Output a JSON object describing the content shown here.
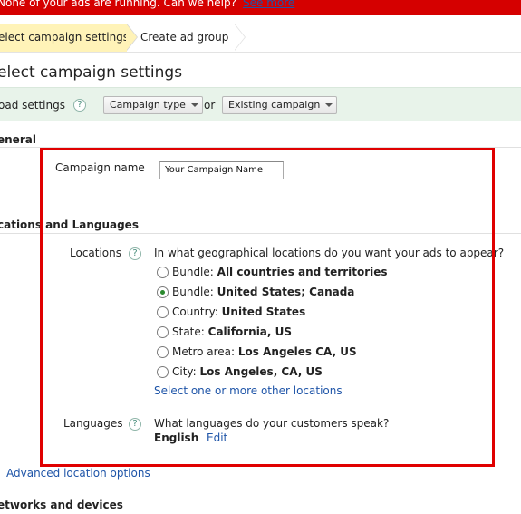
{
  "alert": {
    "text": "None of your ads are running. Can we help?",
    "link": "See more"
  },
  "steps": {
    "active": "elect campaign settings",
    "next": "Create ad group"
  },
  "page_title": "elect campaign settings",
  "load_settings": {
    "label": "oad settings",
    "campaign_type_button": "Campaign type",
    "or": "or",
    "existing_campaign_button": "Existing campaign"
  },
  "general": {
    "heading": "eneral",
    "campaign_name_label": "Campaign name",
    "campaign_name_value": "Your Campaign Name"
  },
  "locations_languages": {
    "heading": "cations and Languages",
    "locations_label": "Locations",
    "locations_question": "In what geographical locations do you want your ads to appear?",
    "options": [
      {
        "prefix": "Bundle:",
        "value": "All countries and territories",
        "checked": false
      },
      {
        "prefix": "Bundle:",
        "value": "United States; Canada",
        "checked": true
      },
      {
        "prefix": "Country:",
        "value": "United States",
        "checked": false
      },
      {
        "prefix": "State:",
        "value": "California, US",
        "checked": false
      },
      {
        "prefix": "Metro area:",
        "value": "Los Angeles CA, US",
        "checked": false
      },
      {
        "prefix": "City:",
        "value": "Los Angeles, CA, US",
        "checked": false
      }
    ],
    "select_other_link": "Select one or more other locations",
    "languages_label": "Languages",
    "languages_question": "What languages do your customers speak?",
    "languages_value": "English",
    "edit_link": "Edit"
  },
  "advanced_location_link": "Advanced location options",
  "networks_heading": "etworks and devices",
  "help_icon_glyph": "?",
  "colors": {
    "alert_bg": "#d50000",
    "active_step_bg": "#fff3b8",
    "load_bar_bg": "#e8f3ea",
    "link": "#1f55a8",
    "highlight_frame": "#e00000"
  }
}
